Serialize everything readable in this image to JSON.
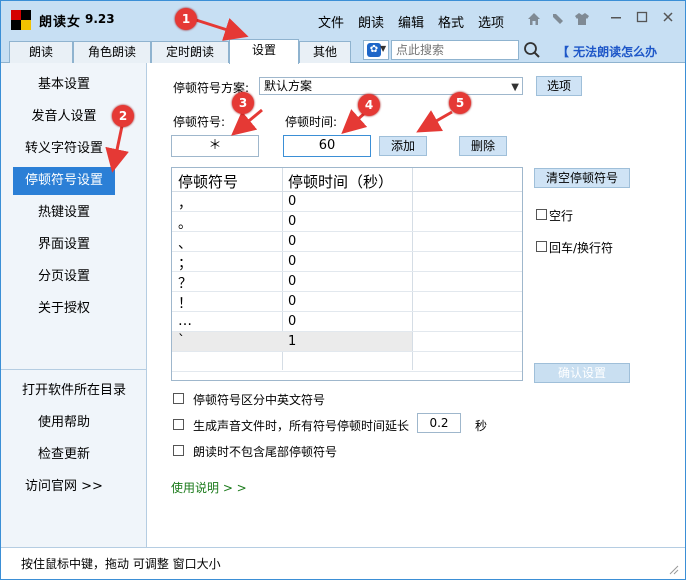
{
  "titlebar": {
    "app_name": "朗读女",
    "version": "9.23",
    "menu": [
      "文件",
      "朗读",
      "编辑",
      "格式",
      "选项"
    ]
  },
  "tabs": [
    "朗读",
    "角色朗读",
    "定时朗读",
    "设置",
    "其他"
  ],
  "active_tab": "设置",
  "search": {
    "placeholder": "点此搜索"
  },
  "help_link": "【 无法朗读怎么办",
  "sidebar": {
    "items": [
      "基本设置",
      "发音人设置",
      "转义字符设置",
      "停顿符号设置",
      "热键设置",
      "界面设置",
      "分页设置",
      "关于授权"
    ],
    "active": "停顿符号设置",
    "links": [
      "打开软件所在目录",
      "使用帮助",
      "检查更新",
      "访问官网 >>"
    ]
  },
  "pause": {
    "scheme_label": "停顿符号方案:",
    "scheme_value": "默认方案",
    "options_button": "选项",
    "symbol_label": "停顿符号:",
    "time_label": "停顿时间:",
    "symbol_value": "＊",
    "time_value": "60",
    "add_button": "添加",
    "delete_button": "删除",
    "clear_button": "清空停顿符号",
    "confirm_button": "确认设置",
    "checkbox_blank_line": "空行",
    "checkbox_newline": "回车/换行符"
  },
  "table": {
    "headers": [
      "停顿符号",
      "停顿时间（秒）"
    ],
    "rows": [
      [
        "，",
        "0"
      ],
      [
        "。",
        "0"
      ],
      [
        "、",
        "0"
      ],
      [
        "；",
        "0"
      ],
      [
        "？",
        "0"
      ],
      [
        "！",
        "0"
      ],
      [
        "…",
        "0"
      ],
      [
        "`",
        "1"
      ]
    ]
  },
  "options": {
    "opt1": "停顿符号区分中英文符号",
    "opt2": "生成声音文件时，所有符号停顿时间延长",
    "opt2_value": "0.2",
    "opt2_unit": "秒",
    "opt3": "朗读时不包含尾部停顿符号"
  },
  "usage_link": "使用说明 > >",
  "status": "按住鼠标中键，拖动 可调整 窗口大小",
  "markers": [
    "1",
    "2",
    "3",
    "4",
    "5"
  ],
  "colors": {
    "accent": "#2b7fd6",
    "marker": "#e53935",
    "title_bg": "#c7dff3"
  }
}
